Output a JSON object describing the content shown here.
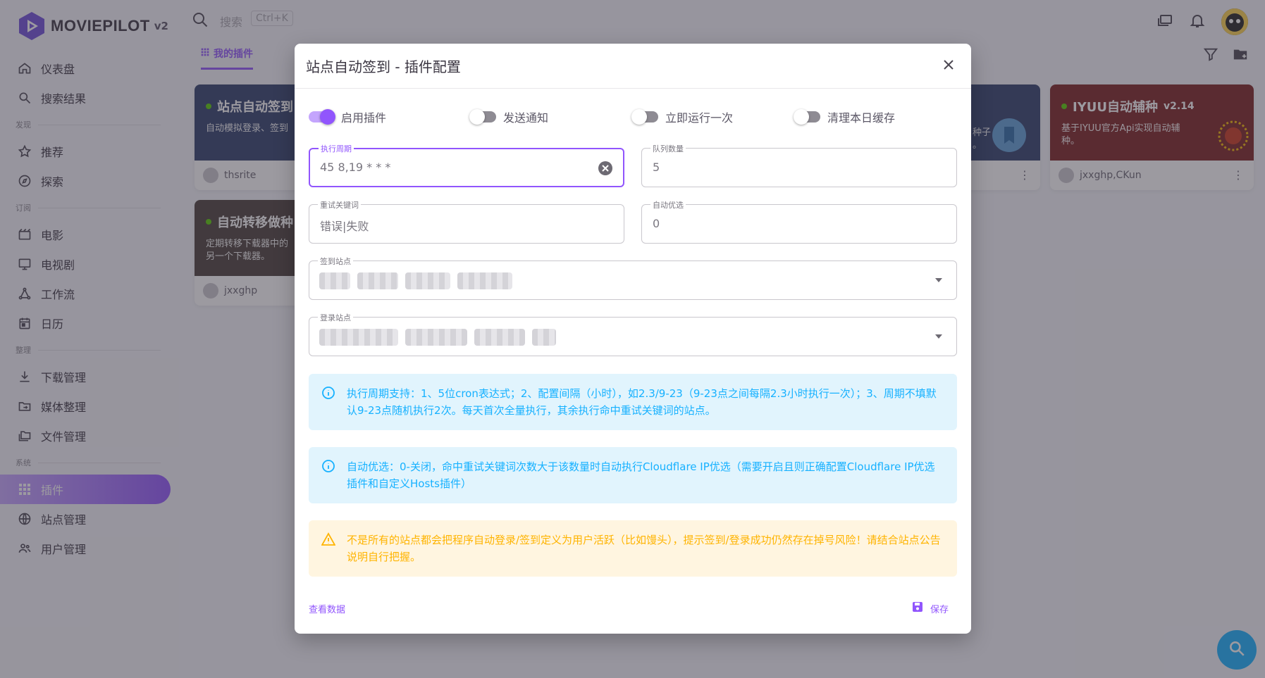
{
  "app": {
    "name": "MOVIEPILOT",
    "version": "v2"
  },
  "sidebar": {
    "items_top": [
      {
        "label": "仪表盘",
        "icon": "home-icon"
      },
      {
        "label": "搜索结果",
        "icon": "search-icon"
      }
    ],
    "sections": [
      {
        "title": "发现",
        "items": [
          {
            "label": "推荐",
            "icon": "star-icon"
          },
          {
            "label": "探索",
            "icon": "compass-icon"
          }
        ]
      },
      {
        "title": "订阅",
        "items": [
          {
            "label": "电影",
            "icon": "movie-icon"
          },
          {
            "label": "电视剧",
            "icon": "tv-icon"
          },
          {
            "label": "工作流",
            "icon": "workflow-icon"
          },
          {
            "label": "日历",
            "icon": "calendar-icon"
          }
        ]
      },
      {
        "title": "整理",
        "items": [
          {
            "label": "下载管理",
            "icon": "download-icon"
          },
          {
            "label": "媒体整理",
            "icon": "folder-move-icon"
          },
          {
            "label": "文件管理",
            "icon": "folders-icon"
          }
        ]
      },
      {
        "title": "系统",
        "items": [
          {
            "label": "插件",
            "icon": "apps-grid-icon",
            "active": true
          },
          {
            "label": "站点管理",
            "icon": "globe-icon"
          },
          {
            "label": "用户管理",
            "icon": "users-icon"
          }
        ]
      }
    ]
  },
  "topbar": {
    "search_placeholder": "搜索",
    "shortcut": "Ctrl+K"
  },
  "tabs": {
    "my_plugins": "我的插件"
  },
  "cards": [
    {
      "title": "站点自动签到",
      "desc": "自动模拟登录、签到",
      "author": "thsrite",
      "color": "#2f3f6b"
    },
    {
      "title": "自动转移做种",
      "desc": "定期转移下载器中的\n另一个下载器。",
      "author": "jxxghp",
      "color": "#4a3f3a"
    },
    {
      "title": "IYUU自动辅种",
      "version": "v2.14",
      "desc": "基于IYUU官方Api实现自动辅\n种。",
      "author": "jxxghp,CKun",
      "color": "#7b2020"
    }
  ],
  "card_partial": {
    "desc": "种子\n。"
  },
  "dialog": {
    "title": "站点自动签到 - 插件配置",
    "switches": [
      {
        "label": "启用插件",
        "on": true
      },
      {
        "label": "发送通知",
        "on": false
      },
      {
        "label": "立即运行一次",
        "on": false
      },
      {
        "label": "清理本日缓存",
        "on": false
      }
    ],
    "fields": {
      "cron": {
        "label": "执行周期",
        "value": "45 8,19 * * *"
      },
      "queue": {
        "label": "队列数量",
        "value": "5"
      },
      "retry": {
        "label": "重试关键词",
        "value": "错误|失败"
      },
      "auto_opt": {
        "label": "自动优选",
        "value": "0"
      },
      "sign_sites": {
        "label": "签到站点"
      },
      "login_sites": {
        "label": "登录站点"
      }
    },
    "alerts": [
      {
        "type": "info",
        "text": "执行周期支持：1、5位cron表达式；2、配置间隔（小时），如2.3/9-23（9-23点之间每隔2.3小时执行一次）；3、周期不填默认9-23点随机执行2次。每天首次全量执行，其余执行命中重试关键词的站点。"
      },
      {
        "type": "info",
        "text": "自动优选：0-关闭，命中重试关键词次数大于该数量时自动执行Cloudflare IP优选（需要开启且则正确配置Cloudflare IP优选插件和自定义Hosts插件）"
      },
      {
        "type": "warn",
        "text": "不是所有的站点都会把程序自动登录/签到定义为用户活跃（比如馒头），提示签到/登录成功仍然存在掉号风险！请结合站点公告说明自行把握。"
      }
    ],
    "footer": {
      "view_data": "查看数据",
      "save": "保存"
    }
  },
  "colors": {
    "primary": "#9155fd",
    "info": "#16b1ff",
    "warning": "#ffb400"
  }
}
